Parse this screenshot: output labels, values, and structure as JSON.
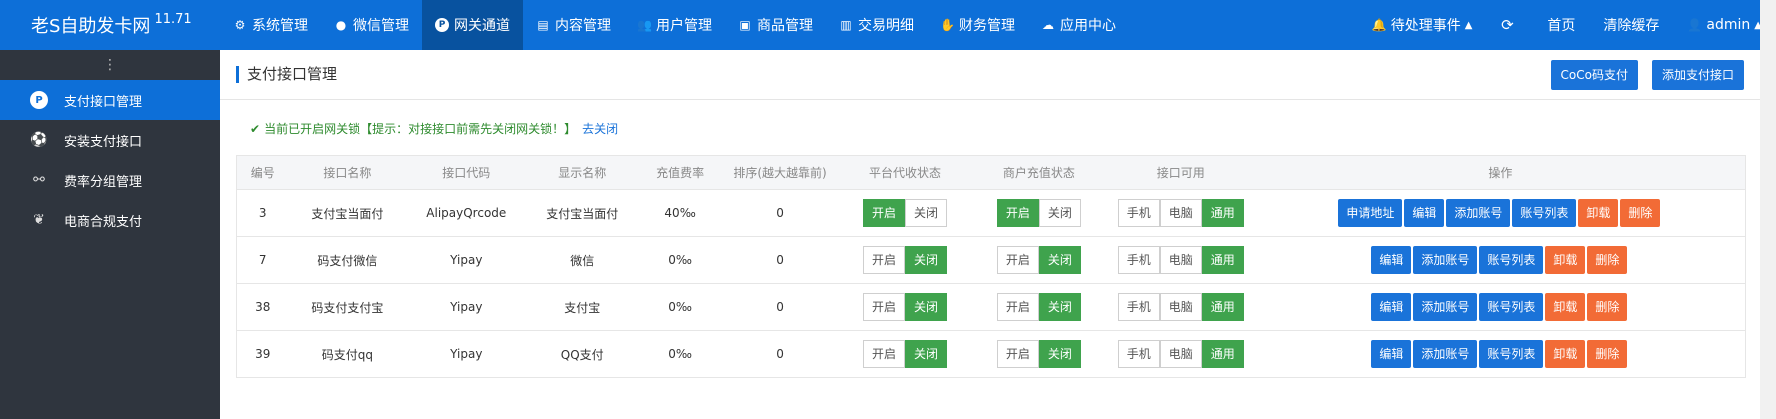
{
  "app": {
    "brand": "老S自助发卡网",
    "version": "11.71"
  },
  "topnav": [
    {
      "label": "系统管理",
      "icon": "gear-icon",
      "active": false
    },
    {
      "label": "微信管理",
      "icon": "wechat-icon",
      "active": false
    },
    {
      "label": "网关通道",
      "icon": "payment-p-icon",
      "active": true
    },
    {
      "label": "内容管理",
      "icon": "document-icon",
      "active": false
    },
    {
      "label": "用户管理",
      "icon": "users-icon",
      "active": false
    },
    {
      "label": "商品管理",
      "icon": "shopping-bag-icon",
      "active": false
    },
    {
      "label": "交易明细",
      "icon": "bar-chart-icon",
      "active": false
    },
    {
      "label": "财务管理",
      "icon": "handshake-icon",
      "active": false
    },
    {
      "label": "应用中心",
      "icon": "cloud-icon",
      "active": false
    }
  ],
  "topright": {
    "events": "待处理事件",
    "home": "首页",
    "clear_cache": "清除缓存",
    "user": "admin"
  },
  "sidebar": {
    "items": [
      {
        "label": "支付接口管理",
        "icon": "payment-p-icon",
        "active": true
      },
      {
        "label": "安装支付接口",
        "icon": "soccer-ball-icon",
        "active": false
      },
      {
        "label": "费率分组管理",
        "icon": "link-icon",
        "active": false
      },
      {
        "label": "电商合规支付",
        "icon": "leaf-icon",
        "active": false
      }
    ]
  },
  "page": {
    "title": "支付接口管理",
    "btn_coco": "CoCo码支付",
    "btn_add": "添加支付接口",
    "notice": "当前已开启网关锁【提示：对接接口前需先关闭网关锁！】",
    "notice_link": "去关闭"
  },
  "table": {
    "headers": [
      "编号",
      "接口名称",
      "接口代码",
      "显示名称",
      "充值费率",
      "排序(越大越靠前)",
      "平台代收状态",
      "商户充值状态",
      "接口可用",
      "操作"
    ],
    "labels": {
      "on": "开启",
      "off": "关闭",
      "mobile": "手机",
      "pc": "电脑",
      "all": "通用",
      "apply": "申请地址",
      "edit": "编辑",
      "add_account": "添加账号",
      "account_list": "账号列表",
      "uninstall": "卸载",
      "delete": "删除"
    },
    "rows": [
      {
        "id": "3",
        "name": "支付宝当面付",
        "code": "AlipayQrcode",
        "display": "支付宝当面付",
        "rate": "40‰",
        "sort": "0",
        "platform_on": true,
        "merchant_on": true,
        "has_apply": true
      },
      {
        "id": "7",
        "name": "码支付微信",
        "code": "Yipay",
        "display": "微信",
        "rate": "0‰",
        "sort": "0",
        "platform_on": false,
        "merchant_on": false,
        "has_apply": false
      },
      {
        "id": "38",
        "name": "码支付支付宝",
        "code": "Yipay",
        "display": "支付宝",
        "rate": "0‰",
        "sort": "0",
        "platform_on": false,
        "merchant_on": false,
        "has_apply": false
      },
      {
        "id": "39",
        "name": "码支付qq",
        "code": "Yipay",
        "display": "QQ支付",
        "rate": "0‰",
        "sort": "0",
        "platform_on": false,
        "merchant_on": false,
        "has_apply": false
      }
    ]
  }
}
